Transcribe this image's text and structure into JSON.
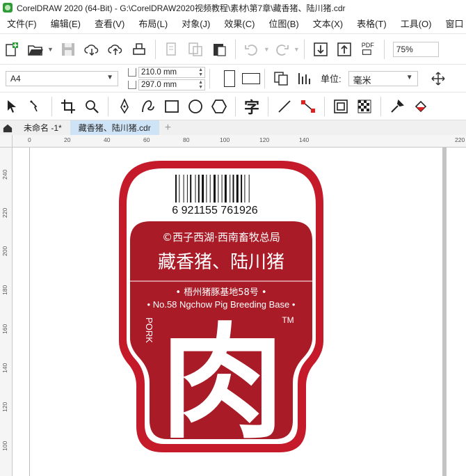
{
  "window": {
    "title": "CorelDRAW 2020 (64-Bit) - G:\\CorelDRAW2020视频教程\\素材\\第7章\\藏香猪、陆川猪.cdr"
  },
  "menu": [
    "文件(F)",
    "编辑(E)",
    "查看(V)",
    "布局(L)",
    "对象(J)",
    "效果(C)",
    "位图(B)",
    "文本(X)",
    "表格(T)",
    "工具(O)",
    "窗口"
  ],
  "toolbar": {
    "icons": [
      "new-document-icon",
      "open-icon",
      "save-icon",
      "cloud-download-icon",
      "cloud-upload-icon",
      "print-icon",
      "import-doc-icon",
      "export-doc-icon",
      "clipboard-icon",
      "undo-icon",
      "redo-icon",
      "import-icon",
      "export-icon",
      "publish-pdf-icon"
    ],
    "pdf_label": "PDF",
    "zoom": "75%"
  },
  "property_bar": {
    "page_size": "A4",
    "width": "210.0 mm",
    "height": "297.0 mm",
    "unit_label": "单位:",
    "unit": "毫米"
  },
  "tools": [
    "pick-tool-icon",
    "shape-tool-icon",
    "crop-tool-icon",
    "zoom-tool-icon",
    "pen-tool-icon",
    "freehand-tool-icon",
    "rectangle-tool-icon",
    "ellipse-tool-icon",
    "polygon-tool-icon",
    "text-tool-icon",
    "line-tool-icon",
    "connector-tool-icon",
    "shadow-tool-icon",
    "transparency-tool-icon",
    "eyedropper-tool-icon",
    "fill-tool-icon"
  ],
  "text_tool_glyph": "字",
  "tabs": {
    "doc1": "未命名 -1*",
    "doc2": "藏香猪、陆川猪.cdr",
    "add": "+"
  },
  "ruler": {
    "h_labels": [
      "0",
      "20",
      "40",
      "60",
      "80",
      "100",
      "120",
      "140",
      "220"
    ],
    "v_labels": [
      "240",
      "220",
      "200",
      "180",
      "160",
      "140",
      "120",
      "100"
    ]
  },
  "label_design": {
    "barcode_number": "6 921155 761926",
    "company": "©西子西湖·西南畜牧总局",
    "product": "藏香猪、陆川猪",
    "base_cn": "• 梧州猪豚基地58号 •",
    "base_en": "• No.58 Ngchow Pig Breeding Base •",
    "pork": "PORK",
    "tm": "TM",
    "big_char": "肉",
    "colors": {
      "red": "#c41a2a",
      "dark_red": "#a01823",
      "white": "#ffffff"
    }
  }
}
